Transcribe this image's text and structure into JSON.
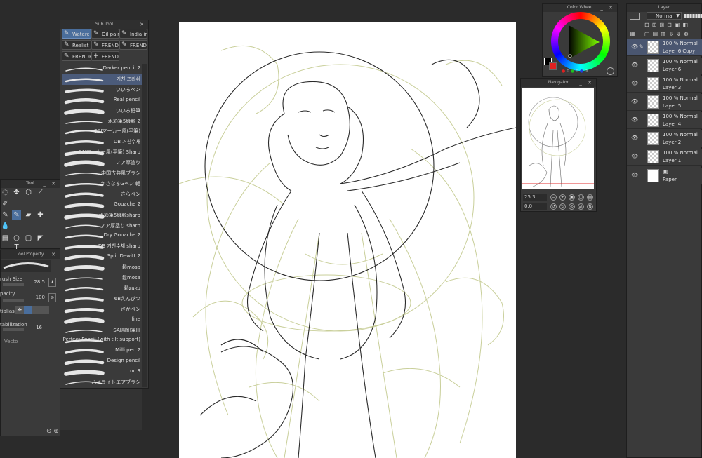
{
  "colors": {
    "background": "#2b2b2b",
    "panel": "#3a3a3a",
    "accent": "#4a6e9c",
    "canvas": "#ffffff",
    "sketch": "#c9cf9a"
  },
  "subtool": {
    "title": "Sub Tool",
    "tabs": [
      "Waterc",
      "Oil paint",
      "India in",
      "Realist",
      "FRENDF",
      "FRENDF",
      "FRENDF",
      "FRENDF"
    ],
    "brushes": [
      "Darker pencil 2",
      "거친 프라쉬",
      "いいろペン",
      "Real pencil",
      "いいろ鉛筆",
      "水彩筆5级胀 2",
      "SAIマーカー風(平筆)",
      "DB 거친수채",
      "SAIマーカー風(平筆) Sharp",
      "ノア厚塗り",
      "中国古典風ブラシ",
      "かさなるGペン 軽",
      "さらペン",
      "Gouache 2",
      "水彩筆5级胀sharp",
      "ノア厚塗り sharp",
      "Dry Gouache 2",
      "DB 거친수채 sharp",
      "Split Dewitt 2",
      "鬆mosa",
      "鬆mosa",
      "鬆zaku",
      "6Bえんぴつ",
      "ざかペン",
      "line",
      "SAI風鉛筆III",
      "Perfect Pencil (with tilt support)",
      "Milli pen 2",
      "Design pencil",
      "oc 3",
      "ハイライトエアブラシ"
    ]
  },
  "tool": {
    "title": "Tool"
  },
  "toolprop": {
    "title": "Tool Property",
    "brush_size_label": "rush Size",
    "brush_size_value": "28.5",
    "opacity_label": "pacity",
    "opacity_value": "100",
    "antialias_label": "tialias",
    "stabilization_label": "tabilization",
    "stabilization_value": "16",
    "vector_label": "Vecto"
  },
  "colorwheel": {
    "title": "Color Wheel",
    "rgb": [
      "0",
      "0",
      "0"
    ]
  },
  "navigator": {
    "title": "Navigator",
    "zoom": "25.3",
    "angle": "0.0"
  },
  "layer": {
    "title": "Layer",
    "blend_mode": "Normal",
    "layers": [
      {
        "mode": "100 % Normal",
        "name": "Layer 6 Copy"
      },
      {
        "mode": "100 % Normal",
        "name": "Layer 6"
      },
      {
        "mode": "100 % Normal",
        "name": "Layer 3"
      },
      {
        "mode": "100 % Normal",
        "name": "Layer 5"
      },
      {
        "mode": "100 % Normal",
        "name": "Layer 4"
      },
      {
        "mode": "100 % Normal",
        "name": "Layer 2"
      },
      {
        "mode": "100 % Normal",
        "name": "Layer 1"
      }
    ],
    "paper": "Paper"
  }
}
